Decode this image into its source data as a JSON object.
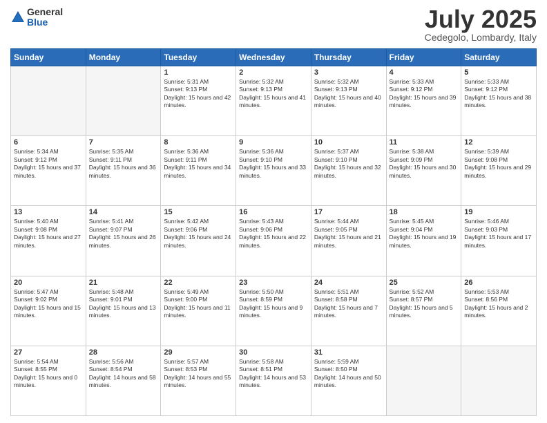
{
  "header": {
    "logo_general": "General",
    "logo_blue": "Blue",
    "month_title": "July 2025",
    "location": "Cedegolo, Lombardy, Italy"
  },
  "calendar": {
    "headers": [
      "Sunday",
      "Monday",
      "Tuesday",
      "Wednesday",
      "Thursday",
      "Friday",
      "Saturday"
    ],
    "rows": [
      [
        {
          "day": "",
          "empty": true
        },
        {
          "day": "",
          "empty": true
        },
        {
          "day": "1",
          "sunrise": "5:31 AM",
          "sunset": "9:13 PM",
          "daylight": "15 hours and 42 minutes."
        },
        {
          "day": "2",
          "sunrise": "5:32 AM",
          "sunset": "9:13 PM",
          "daylight": "15 hours and 41 minutes."
        },
        {
          "day": "3",
          "sunrise": "5:32 AM",
          "sunset": "9:13 PM",
          "daylight": "15 hours and 40 minutes."
        },
        {
          "day": "4",
          "sunrise": "5:33 AM",
          "sunset": "9:12 PM",
          "daylight": "15 hours and 39 minutes."
        },
        {
          "day": "5",
          "sunrise": "5:33 AM",
          "sunset": "9:12 PM",
          "daylight": "15 hours and 38 minutes."
        }
      ],
      [
        {
          "day": "6",
          "sunrise": "5:34 AM",
          "sunset": "9:12 PM",
          "daylight": "15 hours and 37 minutes."
        },
        {
          "day": "7",
          "sunrise": "5:35 AM",
          "sunset": "9:11 PM",
          "daylight": "15 hours and 36 minutes."
        },
        {
          "day": "8",
          "sunrise": "5:36 AM",
          "sunset": "9:11 PM",
          "daylight": "15 hours and 34 minutes."
        },
        {
          "day": "9",
          "sunrise": "5:36 AM",
          "sunset": "9:10 PM",
          "daylight": "15 hours and 33 minutes."
        },
        {
          "day": "10",
          "sunrise": "5:37 AM",
          "sunset": "9:10 PM",
          "daylight": "15 hours and 32 minutes."
        },
        {
          "day": "11",
          "sunrise": "5:38 AM",
          "sunset": "9:09 PM",
          "daylight": "15 hours and 30 minutes."
        },
        {
          "day": "12",
          "sunrise": "5:39 AM",
          "sunset": "9:08 PM",
          "daylight": "15 hours and 29 minutes."
        }
      ],
      [
        {
          "day": "13",
          "sunrise": "5:40 AM",
          "sunset": "9:08 PM",
          "daylight": "15 hours and 27 minutes."
        },
        {
          "day": "14",
          "sunrise": "5:41 AM",
          "sunset": "9:07 PM",
          "daylight": "15 hours and 26 minutes."
        },
        {
          "day": "15",
          "sunrise": "5:42 AM",
          "sunset": "9:06 PM",
          "daylight": "15 hours and 24 minutes."
        },
        {
          "day": "16",
          "sunrise": "5:43 AM",
          "sunset": "9:06 PM",
          "daylight": "15 hours and 22 minutes."
        },
        {
          "day": "17",
          "sunrise": "5:44 AM",
          "sunset": "9:05 PM",
          "daylight": "15 hours and 21 minutes."
        },
        {
          "day": "18",
          "sunrise": "5:45 AM",
          "sunset": "9:04 PM",
          "daylight": "15 hours and 19 minutes."
        },
        {
          "day": "19",
          "sunrise": "5:46 AM",
          "sunset": "9:03 PM",
          "daylight": "15 hours and 17 minutes."
        }
      ],
      [
        {
          "day": "20",
          "sunrise": "5:47 AM",
          "sunset": "9:02 PM",
          "daylight": "15 hours and 15 minutes."
        },
        {
          "day": "21",
          "sunrise": "5:48 AM",
          "sunset": "9:01 PM",
          "daylight": "15 hours and 13 minutes."
        },
        {
          "day": "22",
          "sunrise": "5:49 AM",
          "sunset": "9:00 PM",
          "daylight": "15 hours and 11 minutes."
        },
        {
          "day": "23",
          "sunrise": "5:50 AM",
          "sunset": "8:59 PM",
          "daylight": "15 hours and 9 minutes."
        },
        {
          "day": "24",
          "sunrise": "5:51 AM",
          "sunset": "8:58 PM",
          "daylight": "15 hours and 7 minutes."
        },
        {
          "day": "25",
          "sunrise": "5:52 AM",
          "sunset": "8:57 PM",
          "daylight": "15 hours and 5 minutes."
        },
        {
          "day": "26",
          "sunrise": "5:53 AM",
          "sunset": "8:56 PM",
          "daylight": "15 hours and 2 minutes."
        }
      ],
      [
        {
          "day": "27",
          "sunrise": "5:54 AM",
          "sunset": "8:55 PM",
          "daylight": "15 hours and 0 minutes."
        },
        {
          "day": "28",
          "sunrise": "5:56 AM",
          "sunset": "8:54 PM",
          "daylight": "14 hours and 58 minutes."
        },
        {
          "day": "29",
          "sunrise": "5:57 AM",
          "sunset": "8:53 PM",
          "daylight": "14 hours and 55 minutes."
        },
        {
          "day": "30",
          "sunrise": "5:58 AM",
          "sunset": "8:51 PM",
          "daylight": "14 hours and 53 minutes."
        },
        {
          "day": "31",
          "sunrise": "5:59 AM",
          "sunset": "8:50 PM",
          "daylight": "14 hours and 50 minutes."
        },
        {
          "day": "",
          "empty": true
        },
        {
          "day": "",
          "empty": true
        }
      ]
    ]
  }
}
